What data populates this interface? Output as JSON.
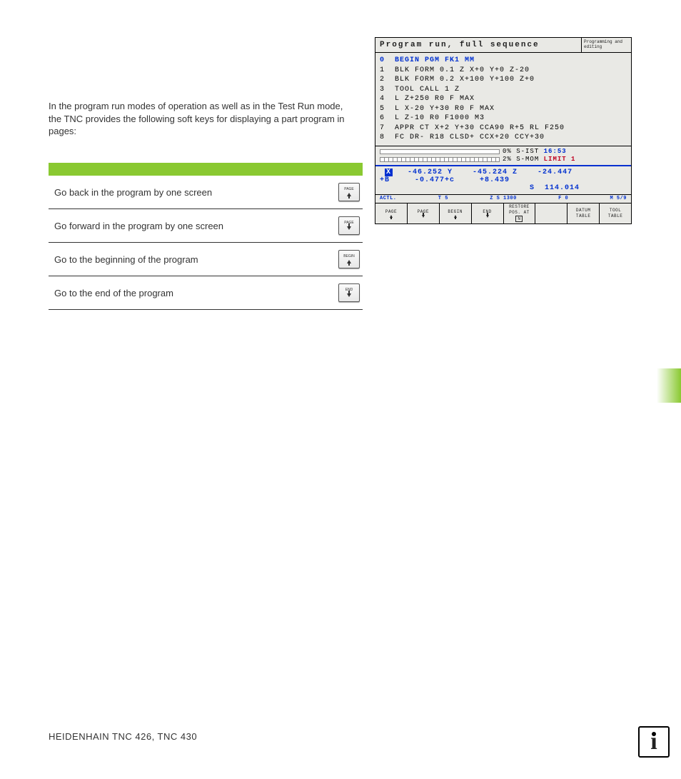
{
  "main_text": "In the program run modes of operation as well as in the Test Run mode, the TNC provides the following soft keys for displaying a part program in pages:",
  "table": {
    "rows": [
      {
        "label": "Go back in the program by one screen",
        "key_caption": "PAGE",
        "arrow": "up"
      },
      {
        "label": "Go forward in the program by one screen",
        "key_caption": "PAGE",
        "arrow": "down"
      },
      {
        "label": "Go to the beginning of the program",
        "key_caption": "BEGIN",
        "arrow": "up"
      },
      {
        "label": "Go to the end of the program",
        "key_caption": "END",
        "arrow": "down"
      }
    ]
  },
  "screen": {
    "title": "Program run, full sequence",
    "mode": "Programming and editing",
    "code": [
      {
        "n": "0",
        "text": "BEGIN PGM FK1 MM",
        "hl": true
      },
      {
        "n": "1",
        "text": "BLK FORM 0.1 Z X+0 Y+0 Z-20"
      },
      {
        "n": "2",
        "text": "BLK FORM 0.2 X+100 Y+100 Z+0"
      },
      {
        "n": "3",
        "text": "TOOL CALL 1 Z"
      },
      {
        "n": "4",
        "text": "L Z+250 R0 F MAX"
      },
      {
        "n": "5",
        "text": "L X-20 Y+30 R0 F MAX"
      },
      {
        "n": "6",
        "text": "L Z-10 R0 F1000 M3"
      },
      {
        "n": "7",
        "text": "APPR CT X+2 Y+30 CCA90 R+5 RL F250"
      },
      {
        "n": "8",
        "text": "FC DR- R18 CLSD+ CCX+20 CCY+30"
      }
    ],
    "status1_pct": "0%",
    "status1_label": "S-IST",
    "status1_val": "16:53",
    "status2_pct": "2%",
    "status2_label": "S-MOM",
    "status2_val": "LIMIT 1",
    "coords_line1_x": "-46.252",
    "coords_line1_y": "-45.224",
    "coords_line1_z": "-24.447",
    "coords_line2_b": "-0.477",
    "coords_line2_c": "+8.439",
    "coords_s": "114.014",
    "actl": {
      "label": "ACTL.",
      "t": "T 5",
      "z": "Z S 1300",
      "f": "F 0",
      "m": "M 5/9"
    },
    "softkeys": [
      {
        "label": "PAGE",
        "arrow": "up"
      },
      {
        "label": "PAGE",
        "arrow": "down"
      },
      {
        "label": "BEGIN",
        "arrow": "up"
      },
      {
        "label": "END",
        "arrow": "down"
      },
      {
        "label": "RESTORE POS. AT",
        "arrow": "none",
        "extra": "N"
      },
      {
        "label": "",
        "arrow": "none"
      },
      {
        "label": "DATUM TABLE",
        "arrow": "none"
      },
      {
        "label": "TOOL TABLE",
        "arrow": "none"
      }
    ]
  },
  "footer": "HEIDENHAIN TNC 426, TNC 430"
}
